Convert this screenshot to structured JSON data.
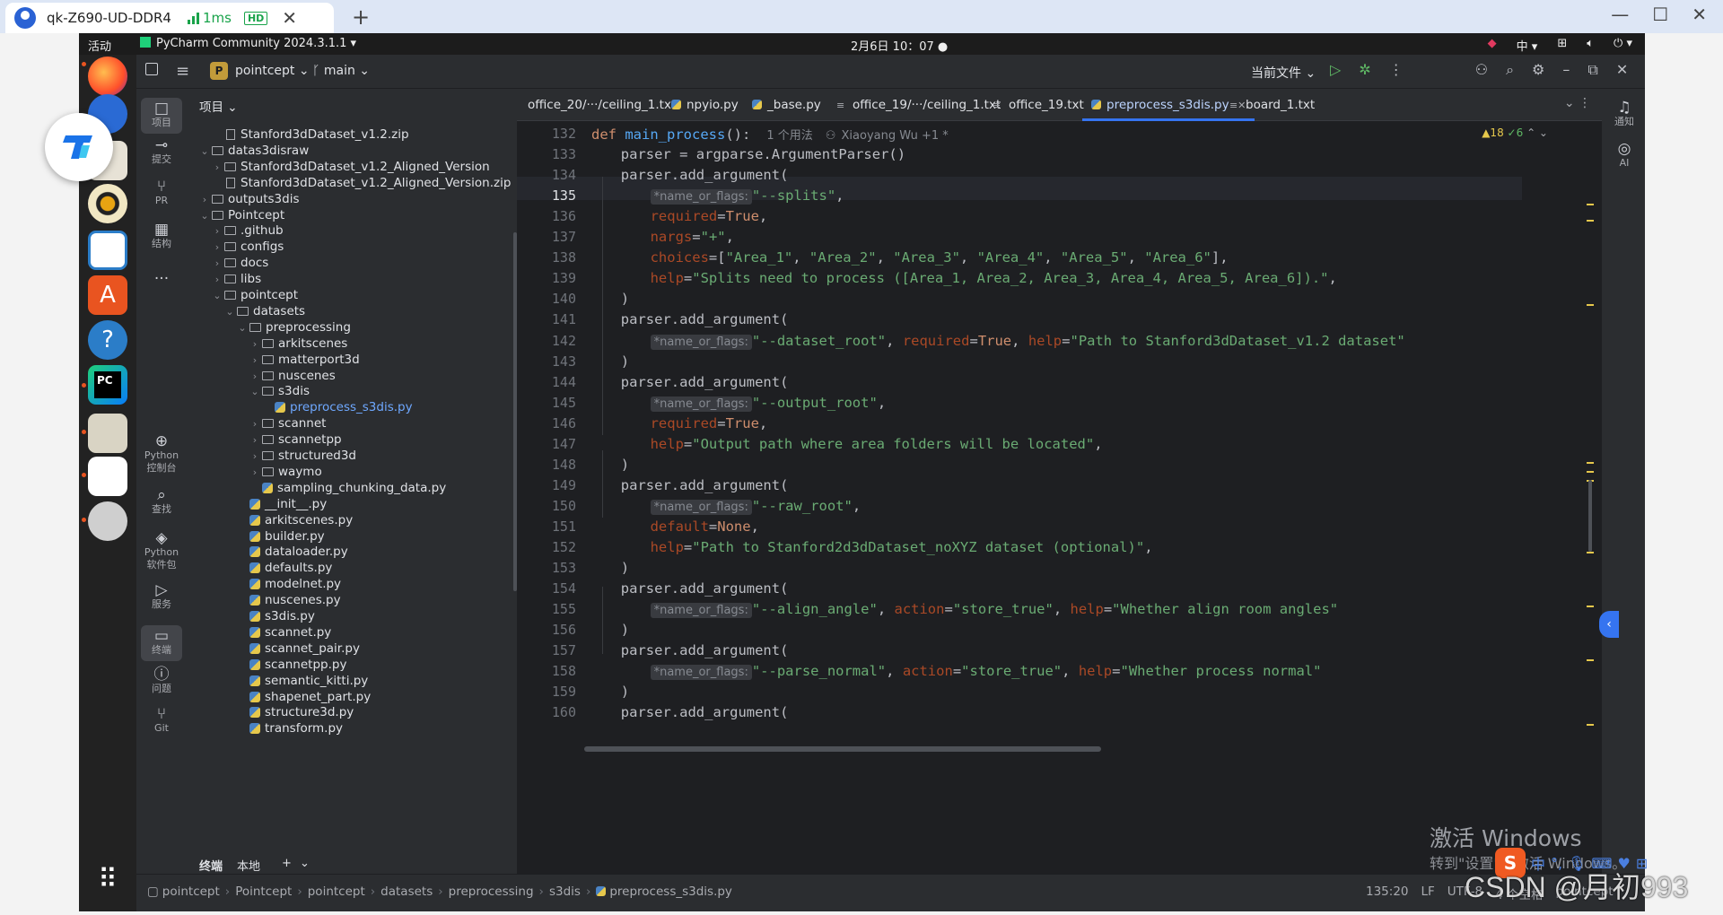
{
  "remote": {
    "tab_title": "qk-Z690-UD-DDR4",
    "latency": "1ms",
    "quality_badge": "HD",
    "new_tab": "+"
  },
  "topbar": {
    "activities": "活动",
    "app": "PyCharm Community 2024.3.1.1 ▾",
    "clock": "2月6日  10：07 ●",
    "lang": "中 ▾"
  },
  "ide": {
    "project_badge": "P",
    "project": "pointcept ⌄",
    "branch": "ᚴ  main ⌄",
    "current_file": "当前文件 ⌄",
    "left_tools": [
      {
        "icon": "□",
        "label": "项目"
      },
      {
        "icon": "⊸",
        "label": "提交"
      },
      {
        "icon": "⑂",
        "label": "PR"
      },
      {
        "icon": "▦",
        "label": "结构"
      },
      {
        "icon": "···",
        "label": ""
      },
      {
        "icon": "⊕",
        "label": "Python\n控制台"
      },
      {
        "icon": "⌕",
        "label": "查找"
      },
      {
        "icon": "◈",
        "label": "Python\n软件包"
      },
      {
        "icon": "▷",
        "label": "服务"
      },
      {
        "icon": "▭",
        "label": "终端"
      },
      {
        "icon": "ⓘ",
        "label": "问题"
      },
      {
        "icon": "⑂",
        "label": "Git"
      }
    ],
    "right_tools": [
      {
        "icon": "♫",
        "label": "通知"
      },
      {
        "icon": "◎",
        "label": "AI"
      }
    ],
    "project_header": "项目 ⌄",
    "tree": [
      {
        "d": 2,
        "t": "zip",
        "e": "",
        "n": "Stanford3dDataset_v1.2.zip"
      },
      {
        "d": 1,
        "t": "dir",
        "e": "⌄",
        "n": "datas3disraw"
      },
      {
        "d": 2,
        "t": "dir",
        "e": "›",
        "n": "Stanford3dDataset_v1.2_Aligned_Version"
      },
      {
        "d": 2,
        "t": "zip",
        "e": "",
        "n": "Stanford3dDataset_v1.2_Aligned_Version.zip"
      },
      {
        "d": 1,
        "t": "dir",
        "e": "›",
        "n": "outputs3dis"
      },
      {
        "d": 1,
        "t": "dir",
        "e": "⌄",
        "n": "Pointcept"
      },
      {
        "d": 2,
        "t": "dir",
        "e": "›",
        "n": ".github"
      },
      {
        "d": 2,
        "t": "dir",
        "e": "›",
        "n": "configs"
      },
      {
        "d": 2,
        "t": "dir",
        "e": "›",
        "n": "docs"
      },
      {
        "d": 2,
        "t": "dir",
        "e": "›",
        "n": "libs"
      },
      {
        "d": 2,
        "t": "dir",
        "e": "⌄",
        "n": "pointcept"
      },
      {
        "d": 3,
        "t": "dir",
        "e": "⌄",
        "n": "datasets"
      },
      {
        "d": 4,
        "t": "dir",
        "e": "⌄",
        "n": "preprocessing"
      },
      {
        "d": 5,
        "t": "dir",
        "e": "›",
        "n": "arkitscenes"
      },
      {
        "d": 5,
        "t": "dir",
        "e": "›",
        "n": "matterport3d"
      },
      {
        "d": 5,
        "t": "dir",
        "e": "›",
        "n": "nuscenes"
      },
      {
        "d": 5,
        "t": "dir",
        "e": "⌄",
        "n": "s3dis"
      },
      {
        "d": 6,
        "t": "py",
        "e": "",
        "n": "preprocess_s3dis.py",
        "sel": true
      },
      {
        "d": 5,
        "t": "dir",
        "e": "›",
        "n": "scannet"
      },
      {
        "d": 5,
        "t": "dir",
        "e": "›",
        "n": "scannetpp"
      },
      {
        "d": 5,
        "t": "dir",
        "e": "›",
        "n": "structured3d"
      },
      {
        "d": 5,
        "t": "dir",
        "e": "›",
        "n": "waymo"
      },
      {
        "d": 5,
        "t": "py",
        "e": "",
        "n": "sampling_chunking_data.py"
      },
      {
        "d": 4,
        "t": "py",
        "e": "",
        "n": "__init__.py"
      },
      {
        "d": 4,
        "t": "py",
        "e": "",
        "n": "arkitscenes.py"
      },
      {
        "d": 4,
        "t": "py",
        "e": "",
        "n": "builder.py"
      },
      {
        "d": 4,
        "t": "py",
        "e": "",
        "n": "dataloader.py"
      },
      {
        "d": 4,
        "t": "py",
        "e": "",
        "n": "defaults.py"
      },
      {
        "d": 4,
        "t": "py",
        "e": "",
        "n": "modelnet.py"
      },
      {
        "d": 4,
        "t": "py",
        "e": "",
        "n": "nuscenes.py"
      },
      {
        "d": 4,
        "t": "py",
        "e": "",
        "n": "s3dis.py"
      },
      {
        "d": 4,
        "t": "py",
        "e": "",
        "n": "scannet.py"
      },
      {
        "d": 4,
        "t": "py",
        "e": "",
        "n": "scannet_pair.py"
      },
      {
        "d": 4,
        "t": "py",
        "e": "",
        "n": "scannetpp.py"
      },
      {
        "d": 4,
        "t": "py",
        "e": "",
        "n": "semantic_kitti.py"
      },
      {
        "d": 4,
        "t": "py",
        "e": "",
        "n": "shapenet_part.py"
      },
      {
        "d": 4,
        "t": "py",
        "e": "",
        "n": "structure3d.py"
      },
      {
        "d": 4,
        "t": "py",
        "e": "",
        "n": "transform.py"
      }
    ],
    "bottom_tabs": [
      "终端",
      "本地",
      "+",
      "⌄"
    ],
    "editor_tabs": [
      {
        "name": "office_20/···/ceiling_1.txt",
        "icon": "txt"
      },
      {
        "name": "npyio.py",
        "icon": "py"
      },
      {
        "name": "_base.py",
        "icon": "py"
      },
      {
        "name": "office_19/···/ceiling_1.txt",
        "icon": "txt"
      },
      {
        "name": "office_19.txt",
        "icon": "txt"
      },
      {
        "name": "preprocess_s3dis.py",
        "icon": "py",
        "active": true
      },
      {
        "name": "board_1.txt",
        "icon": "txt"
      }
    ],
    "inspections": {
      "warnings": "▲18",
      "ok": "✓6",
      "nav": "⌃ ⌄"
    },
    "code_meta": {
      "usages": "1 个用法",
      "author": "Xiaoyang Wu +1 *"
    },
    "lines": [
      {
        "n": "132",
        "i": 0,
        "s": [
          [
            "kw",
            "def "
          ],
          [
            "fn",
            "main_process"
          ],
          [
            "",
            "():"
          ]
        ],
        "meta": true
      },
      {
        "n": "133",
        "i": 1,
        "s": [
          [
            "",
            "parser = argparse.ArgumentParser()"
          ]
        ]
      },
      {
        "n": "134",
        "i": 1,
        "s": [
          [
            "",
            "parser.add_argument("
          ]
        ]
      },
      {
        "n": "135",
        "i": 2,
        "s": [
          [
            "hint",
            "*name_or_flags:"
          ],
          [
            "st",
            "\"--splits\""
          ],
          [
            "",
            ","
          ]
        ]
      },
      {
        "n": "136",
        "i": 2,
        "s": [
          [
            "pm",
            "required"
          ],
          [
            "",
            "="
          ],
          [
            "kw",
            "True"
          ],
          [
            "",
            ","
          ]
        ]
      },
      {
        "n": "137",
        "i": 2,
        "s": [
          [
            "pm",
            "nargs"
          ],
          [
            "",
            "="
          ],
          [
            "st",
            "\"+\""
          ],
          [
            "",
            ","
          ]
        ]
      },
      {
        "n": "138",
        "i": 2,
        "s": [
          [
            "pm",
            "choices"
          ],
          [
            "",
            "=["
          ],
          [
            "st",
            "\"Area_1\""
          ],
          [
            "",
            ", "
          ],
          [
            "st",
            "\"Area_2\""
          ],
          [
            "",
            ", "
          ],
          [
            "st",
            "\"Area_3\""
          ],
          [
            "",
            ", "
          ],
          [
            "st",
            "\"Area_4\""
          ],
          [
            "",
            ", "
          ],
          [
            "st",
            "\"Area_5\""
          ],
          [
            "",
            ", "
          ],
          [
            "st",
            "\"Area_6\""
          ],
          [
            "",
            "],"
          ]
        ]
      },
      {
        "n": "139",
        "i": 2,
        "s": [
          [
            "pm",
            "help"
          ],
          [
            "",
            "="
          ],
          [
            "st",
            "\"Splits need to process ([Area_1, Area_2, Area_3, Area_4, Area_5, Area_6]).\""
          ],
          [
            "",
            ","
          ]
        ]
      },
      {
        "n": "140",
        "i": 1,
        "s": [
          [
            "",
            ")"
          ]
        ]
      },
      {
        "n": "141",
        "i": 1,
        "s": [
          [
            "",
            "parser.add_argument("
          ]
        ]
      },
      {
        "n": "142",
        "i": 2,
        "s": [
          [
            "hint",
            "*name_or_flags:"
          ],
          [
            "st",
            "\"--dataset_root\""
          ],
          [
            "",
            ", "
          ],
          [
            "pm",
            "required"
          ],
          [
            "",
            "="
          ],
          [
            "kw",
            "True"
          ],
          [
            "",
            ", "
          ],
          [
            "pm",
            "help"
          ],
          [
            "",
            "="
          ],
          [
            "st",
            "\"Path to Stanford3dDataset_v1.2 dataset\""
          ]
        ]
      },
      {
        "n": "143",
        "i": 1,
        "s": [
          [
            "",
            ")"
          ]
        ]
      },
      {
        "n": "144",
        "i": 1,
        "s": [
          [
            "",
            "parser.add_argument("
          ]
        ]
      },
      {
        "n": "145",
        "i": 2,
        "s": [
          [
            "hint",
            "*name_or_flags:"
          ],
          [
            "st",
            "\"--output_root\""
          ],
          [
            "",
            ","
          ]
        ]
      },
      {
        "n": "146",
        "i": 2,
        "s": [
          [
            "pm",
            "required"
          ],
          [
            "",
            "="
          ],
          [
            "kw",
            "True"
          ],
          [
            "",
            ","
          ]
        ]
      },
      {
        "n": "147",
        "i": 2,
        "s": [
          [
            "pm",
            "help"
          ],
          [
            "",
            "="
          ],
          [
            "st",
            "\"Output path where area folders will be located\""
          ],
          [
            "",
            ","
          ]
        ]
      },
      {
        "n": "148",
        "i": 1,
        "s": [
          [
            "",
            ")"
          ]
        ]
      },
      {
        "n": "149",
        "i": 1,
        "s": [
          [
            "",
            "parser.add_argument("
          ]
        ]
      },
      {
        "n": "150",
        "i": 2,
        "s": [
          [
            "hint",
            "*name_or_flags:"
          ],
          [
            "st",
            "\"--raw_root\""
          ],
          [
            "",
            ","
          ]
        ]
      },
      {
        "n": "151",
        "i": 2,
        "s": [
          [
            "pm",
            "default"
          ],
          [
            "",
            "="
          ],
          [
            "kw",
            "None"
          ],
          [
            "",
            ","
          ]
        ]
      },
      {
        "n": "152",
        "i": 2,
        "s": [
          [
            "pm",
            "help"
          ],
          [
            "",
            "="
          ],
          [
            "st",
            "\"Path to Stanford2d3dDataset_noXYZ dataset (optional)\""
          ],
          [
            "",
            ","
          ]
        ]
      },
      {
        "n": "153",
        "i": 1,
        "s": [
          [
            "",
            ")"
          ]
        ]
      },
      {
        "n": "154",
        "i": 1,
        "s": [
          [
            "",
            "parser.add_argument("
          ]
        ]
      },
      {
        "n": "155",
        "i": 2,
        "s": [
          [
            "hint",
            "*name_or_flags:"
          ],
          [
            "st",
            "\"--align_angle\""
          ],
          [
            "",
            ", "
          ],
          [
            "pm",
            "action"
          ],
          [
            "",
            "="
          ],
          [
            "st",
            "\"store_true\""
          ],
          [
            "",
            ", "
          ],
          [
            "pm",
            "help"
          ],
          [
            "",
            "="
          ],
          [
            "st",
            "\"Whether align room angles\""
          ]
        ]
      },
      {
        "n": "156",
        "i": 1,
        "s": [
          [
            "",
            ")"
          ]
        ]
      },
      {
        "n": "157",
        "i": 1,
        "s": [
          [
            "",
            "parser.add_argument("
          ]
        ]
      },
      {
        "n": "158",
        "i": 2,
        "s": [
          [
            "hint",
            "*name_or_flags:"
          ],
          [
            "st",
            "\"--parse_normal\""
          ],
          [
            "",
            ", "
          ],
          [
            "pm",
            "action"
          ],
          [
            "",
            "="
          ],
          [
            "st",
            "\"store_true\""
          ],
          [
            "",
            ", "
          ],
          [
            "pm",
            "help"
          ],
          [
            "",
            "="
          ],
          [
            "st",
            "\"Whether process normal\""
          ]
        ]
      },
      {
        "n": "159",
        "i": 1,
        "s": [
          [
            "",
            ")"
          ]
        ]
      },
      {
        "n": "160",
        "i": 1,
        "s": [
          [
            "",
            "parser.add_argument("
          ]
        ]
      }
    ],
    "breadcrumb": [
      "pointcept",
      "Pointcept",
      "pointcept",
      "datasets",
      "preprocessing",
      "s3dis",
      "preprocess_s3dis.py"
    ],
    "status_right": [
      "135:20",
      "LF",
      "UTF-8",
      "4 个空格",
      "pointcept"
    ]
  },
  "overlay": {
    "activate_line1": "激活 Windows",
    "activate_line2": "转到\"设置\"以激活 Windows。",
    "ime_glyph": "S",
    "ime_lang": "中",
    "csdn": "CSDN @月初993"
  }
}
